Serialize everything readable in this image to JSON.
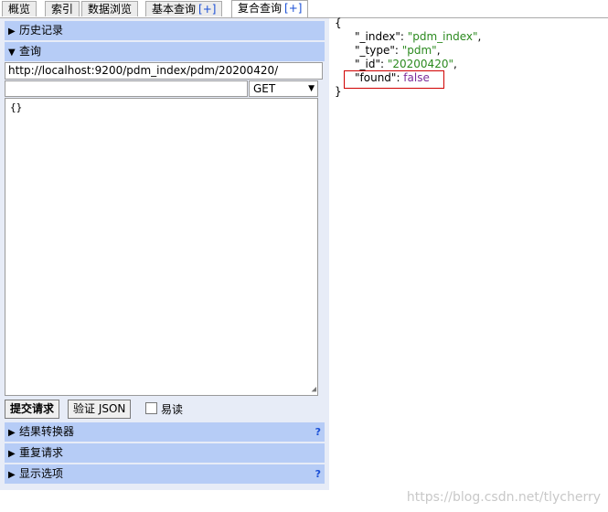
{
  "tabs": [
    {
      "label": "概览"
    },
    {
      "label": "索引"
    },
    {
      "label": "数据浏览"
    },
    {
      "label": "基本查询",
      "plus": "[+]"
    },
    {
      "label": "复合查询",
      "plus": "[+]"
    }
  ],
  "sections": {
    "history": "历史记录",
    "query": "查询",
    "transformer": "结果转换器",
    "repeat": "重复请求",
    "display": "显示选项"
  },
  "help_glyph": "?",
  "query": {
    "url": "http://localhost:9200/pdm_index/pdm/20200420/",
    "path": "",
    "method": "GET",
    "body": "{}"
  },
  "buttons": {
    "submit": "提交请求",
    "validate": "验证 JSON",
    "easy_read": "易读"
  },
  "response": {
    "open_brace": "{",
    "close_brace": "}",
    "fields": [
      {
        "key": "\"_index\"",
        "value": "\"pdm_index\"",
        "type": "str",
        "comma": ","
      },
      {
        "key": "\"_type\"",
        "value": "\"pdm\"",
        "type": "str",
        "comma": ","
      },
      {
        "key": "\"_id\"",
        "value": "\"20200420\"",
        "type": "str",
        "comma": ","
      },
      {
        "key": "\"found\"",
        "value": "false",
        "type": "bool",
        "comma": ""
      }
    ]
  },
  "watermark": "https://blog.csdn.net/tlycherry",
  "colors": {
    "section_bar": "#b6ccf6",
    "panel_bg": "#e7ecf7",
    "string_value": "#2b8a1f",
    "boolean_value": "#7b2d9a",
    "highlight_border": "#d00000"
  }
}
